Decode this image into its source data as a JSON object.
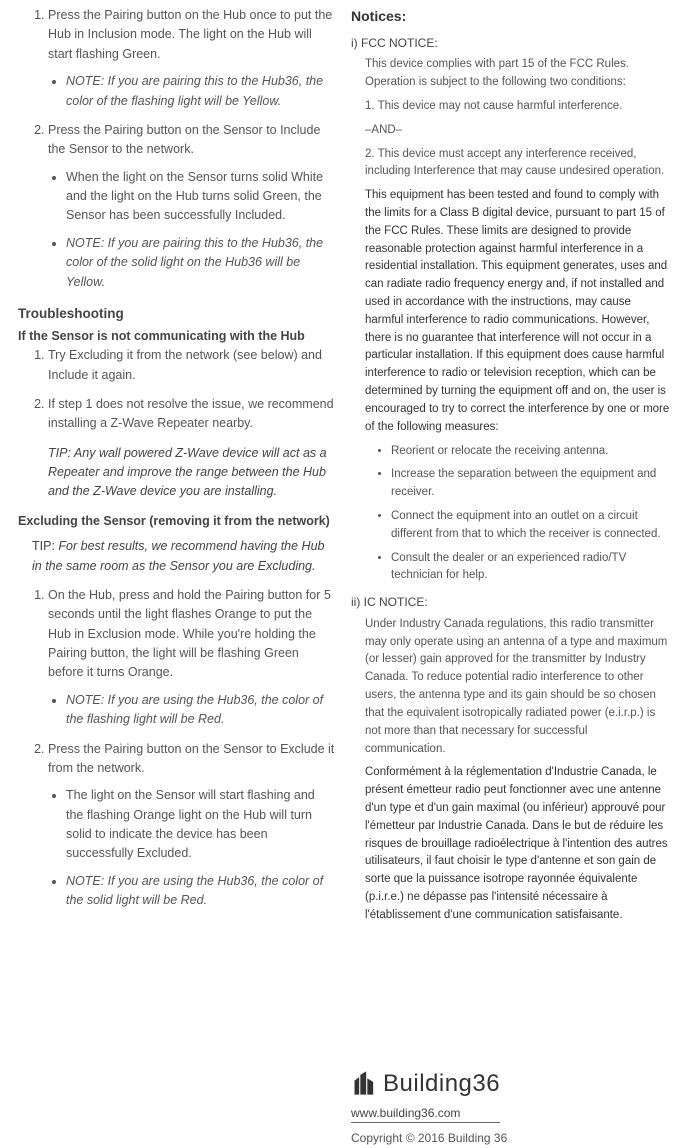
{
  "left": {
    "step1": "Press the Pairing button on the Hub once to put the Hub in Inclusion mode.  The light on the Hub will start flashing Green.",
    "step1_note": "NOTE: If you are pairing this to the Hub36, the color of the flashing light will be Yellow.",
    "step2": "Press the Pairing button on the Sensor to Include the Sensor to the network.",
    "step2_b1": "When the light on the Sensor turns solid White and the light on the Hub turns solid Green, the Sensor has been successfully Included.",
    "step2_b2": "NOTE: If you are pairing this to the Hub36, the color of the solid light on the Hub36 will be Yellow.",
    "trouble_h": "Troubleshooting",
    "trouble_sub": "If the Sensor is not communicating with the Hub",
    "t1": "Try Excluding it from the network (see below) and Include it again.",
    "t2": "If step 1 does not resolve the issue, we recommend installing a Z-Wave Repeater nearby.",
    "tip": "TIP: Any wall powered Z-Wave device will act as a Repeater and improve the range between the Hub and the Z-Wave device you are installing.",
    "excl_h": "Excluding the Sensor (removing it from the network)",
    "excl_tip_lbl": "TIP:",
    "excl_tip": "  For best results, we recommend having the Hub in the same room as the Sensor you are Excluding.",
    "e1": "On the Hub, press and hold the Pairing button for 5 seconds until the light flashes Orange to put the Hub in Exclusion mode.  While you're holding the Pairing button, the light will be flashing Green before it turns Orange.",
    "e1_note": "NOTE: If you are using the Hub36, the color of the flashing light will be Red.",
    "e2": "Press the Pairing button on the Sensor to Exclude it from the network.",
    "e2_b1": "The light on the Sensor will start flashing and the flashing Orange light on the Hub will turn solid to indicate the device has been successfully Excluded.",
    "e2_b2": "NOTE: If you are using the Hub36, the color of the solid light will be Red."
  },
  "right": {
    "notices": "Notices:",
    "fcc_h": "i) FCC NOTICE:",
    "fcc_p1": "This device complies with part 15 of the FCC Rules. Operation is subject to the following two conditions:",
    "fcc_p2": "1. This device may not cause harmful interference.",
    "fcc_and": "–AND–",
    "fcc_p3": "2. This device must accept any interference received, including Interference that may cause undesired operation.",
    "fcc_p4": "This equipment has been tested and found to comply with the limits for a Class B digital device, pursuant to part 15 of the FCC Rules. These limits are designed to provide reasonable protection against harmful interference in a residential installation. This equipment generates, uses and can radiate radio frequency energy and, if not installed and used in accordance with the instructions, may cause harmful interference to radio communications. However, there is no guarantee that interference will not occur in a particular installation. If this equipment does cause harmful interference to radio or television reception, which can be determined by turning the equipment off and on, the user is encouraged to try to correct the interference by one or more of the following measures:",
    "m1": "Reorient or relocate the receiving antenna.",
    "m2": "Increase the separation between the equipment and receiver.",
    "m3": "Connect the equipment into an outlet on a circuit different from that to which the receiver is connected.",
    "m4": "Consult the dealer or an experienced radio/TV technician for help.",
    "ic_h": "ii) IC NOTICE:",
    "ic_p1": "Under Industry Canada regulations, this radio transmitter may only operate using an antenna of a type and maximum (or lesser) gain approved for the transmitter by Industry Canada. To reduce potential radio interference to other users, the antenna type and its gain should be so chosen that the equivalent isotropically radiated power (e.i.r.p.) is not more than that necessary for successful communication.",
    "ic_p2": "Conformément à la réglementation d'Industrie Canada, le présent émetteur radio peut fonctionner avec une antenne d'un type et d'un gain maximal (ou inférieur) approuvé pour l'émetteur par Industrie Canada. Dans le but de réduire les risques de brouillage radioélectrique à l'intention des autres utilisateurs, il faut choisir le type d'antenne et son gain de sorte que la puissance isotrope rayonnée équivalente (p.i.r.e.) ne dépasse pas l'intensité nécessaire à l'établissement d'une communication satisfaisante.",
    "logo_text": "Building36",
    "www": "www.building36.com",
    "copyright": "Copyright © 2016 Building 36"
  }
}
